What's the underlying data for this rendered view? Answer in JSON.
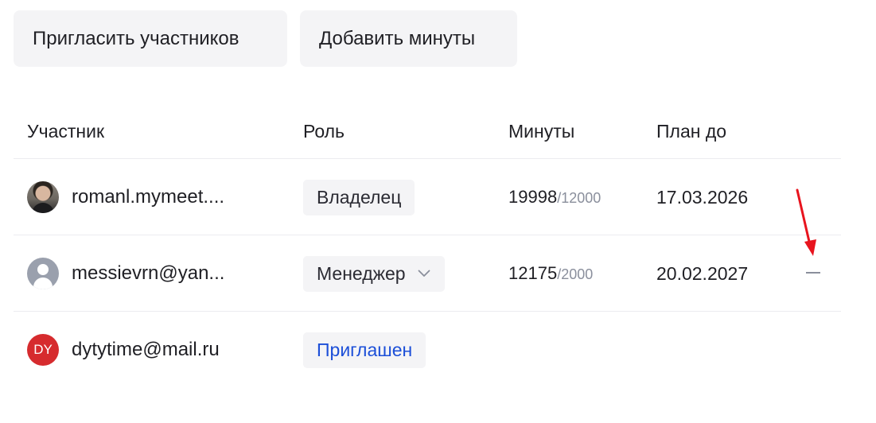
{
  "toolbar": {
    "invite_label": "Пригласить участников",
    "add_minutes_label": "Добавить минуты"
  },
  "table": {
    "headers": {
      "member": "Участник",
      "role": "Роль",
      "minutes": "Минуты",
      "plan_until": "План до"
    },
    "rows": [
      {
        "avatar": {
          "type": "photo"
        },
        "email": "romanl.mymeet....",
        "role": "Владелец",
        "minutes_used": "19998",
        "minutes_limit": "/12000",
        "plan_until": "17.03.2026"
      },
      {
        "avatar": {
          "type": "default-user-icon"
        },
        "email": "messievrn@yan...",
        "role": "Менеджер",
        "minutes_used": "12175",
        "minutes_limit": "/2000",
        "plan_until": "20.02.2027",
        "action_icon": "remove-dash-icon"
      },
      {
        "avatar": {
          "type": "initials",
          "initials": "DY"
        },
        "email": "dytytime@mail.ru",
        "role": "Приглашен",
        "minutes_used": "",
        "minutes_limit": "",
        "plan_until": ""
      }
    ]
  },
  "colors": {
    "button_bg": "#f4f4f6",
    "text": "#1f1f24",
    "muted": "#8a8f9c",
    "invited_link": "#1c4fd8",
    "avatar_initials_bg": "#d62b2e",
    "annotation_arrow": "#e8141e"
  }
}
